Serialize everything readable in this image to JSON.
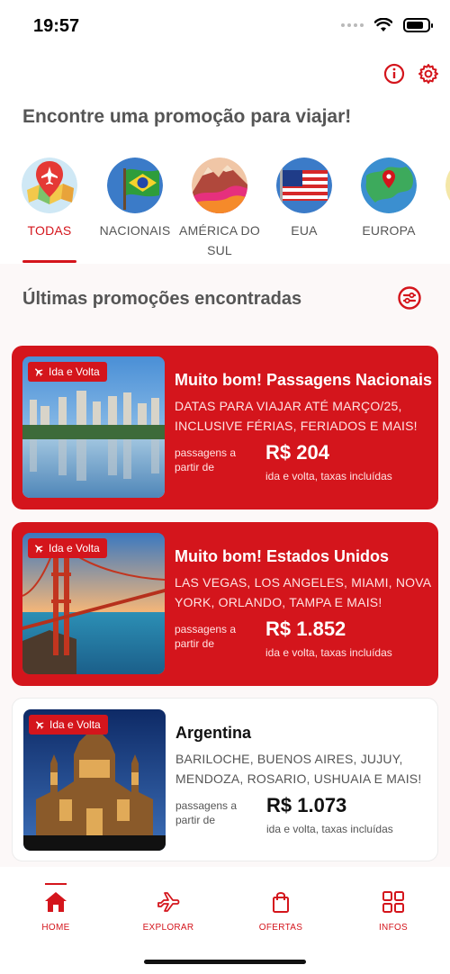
{
  "status_bar": {
    "time": "19:57"
  },
  "header": {
    "title": "Encontre uma promoção para viajar!",
    "info_icon": "info-icon",
    "settings_icon": "gear-icon"
  },
  "categories": [
    {
      "label": "TODAS",
      "icon": "plane-map-icon",
      "active": true
    },
    {
      "label": "NACIONAIS",
      "icon": "brazil-flag-icon"
    },
    {
      "label": "AMÉRICA DO SUL",
      "icon": "mountains-icon"
    },
    {
      "label": "EUA",
      "icon": "usa-flag-icon"
    },
    {
      "label": "EUROPA",
      "icon": "europe-map-icon"
    }
  ],
  "promos": {
    "section_title": "Últimas promoções encontradas",
    "filter_icon": "filter-icon",
    "items": [
      {
        "badge": "Ida e Volta",
        "title": "Muito bom! Passagens Nacionais",
        "description": "DATAS PARA VIAJAR ATÉ MARÇO/25, INCLUSIVE FÉRIAS, FERIADOS E MAIS!",
        "from_label": "passagens a partir de",
        "price": "R$ 204",
        "note": "ida e volta, taxas incluídas",
        "style": "red"
      },
      {
        "badge": "Ida e Volta",
        "title": "Muito bom! Estados Unidos",
        "description": "LAS VEGAS, LOS ANGELES, MIAMI, NOVA YORK, ORLANDO, TAMPA E MAIS!",
        "from_label": "passagens a partir de",
        "price": "R$ 1.852",
        "note": "ida e volta, taxas incluídas",
        "style": "red"
      },
      {
        "badge": "Ida e Volta",
        "title": "Argentina",
        "description": "BARILOCHE, BUENOS AIRES, JUJUY, MENDOZA, ROSARIO, USHUAIA E MAIS!",
        "from_label": "passagens a partir de",
        "price": "R$ 1.073",
        "note": "ida e volta, taxas incluídas",
        "style": "white"
      }
    ]
  },
  "tabbar": [
    {
      "label": "HOME",
      "icon": "home-icon",
      "active": true
    },
    {
      "label": "EXPLORAR",
      "icon": "plane-icon"
    },
    {
      "label": "OFERTAS",
      "icon": "shopping-bag-icon"
    },
    {
      "label": "INFOS",
      "icon": "grid-icon"
    }
  ],
  "colors": {
    "accent": "#d4151c",
    "section_bg": "#fcf8f8",
    "title_gray": "#555555"
  }
}
